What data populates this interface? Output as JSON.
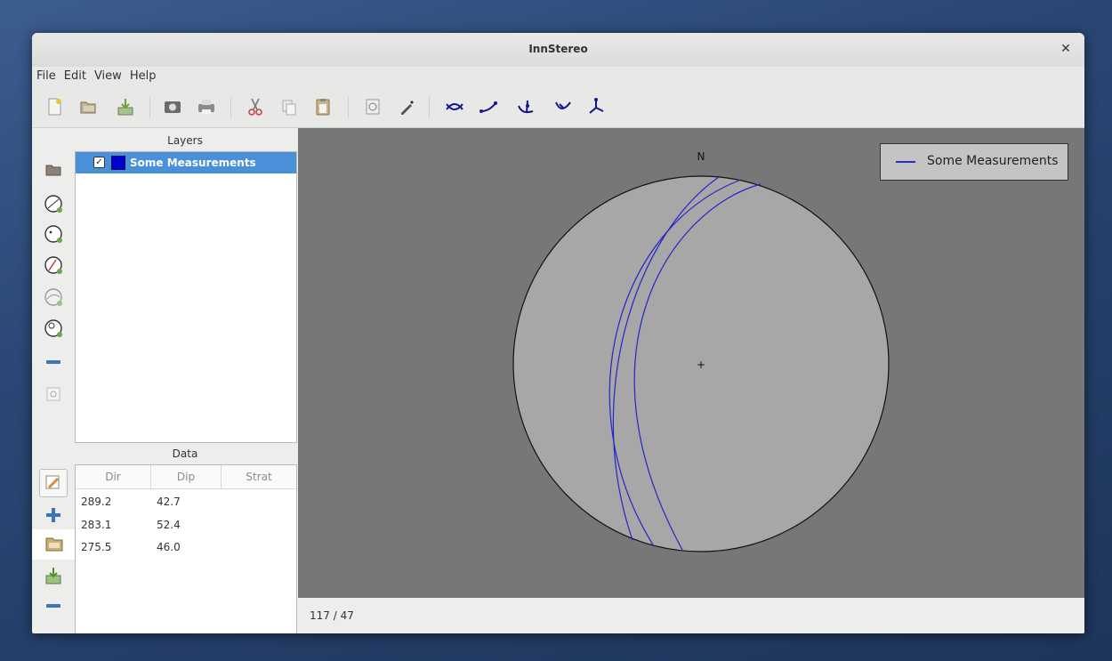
{
  "window": {
    "title": "InnStereo"
  },
  "menu": [
    "File",
    "Edit",
    "View",
    "Help"
  ],
  "toolbar": {
    "buttons": [
      "new-file-icon",
      "open-folder-icon",
      "import-icon",
      "screenshot-icon",
      "print-icon",
      "cut-icon",
      "copy-icon",
      "paste-icon",
      "layer-properties-icon",
      "pick-color-icon",
      "best-fit-plane-icon",
      "best-fit-line-icon",
      "mean-vector-icon",
      "rotate-icon",
      "cluster-icon"
    ]
  },
  "layers_panel": {
    "title": "Layers",
    "items": [
      {
        "name": "Some Measurements",
        "checked": true,
        "color": "#0000cc"
      }
    ]
  },
  "data_panel": {
    "title": "Data",
    "columns": [
      "Dir",
      "Dip",
      "Strat"
    ],
    "rows": [
      {
        "dir": "289.2",
        "dip": "42.7",
        "strat": ""
      },
      {
        "dir": "283.1",
        "dip": "52.4",
        "strat": ""
      },
      {
        "dir": "275.5",
        "dip": "46.0",
        "strat": ""
      }
    ]
  },
  "plot": {
    "north_label": "N",
    "center_marker": "+",
    "legend": {
      "label": "Some Measurements",
      "color": "#2a2acc"
    }
  },
  "status": {
    "text": "117 / 47"
  }
}
